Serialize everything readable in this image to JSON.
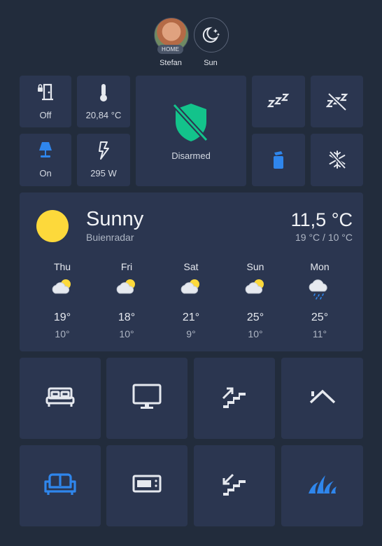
{
  "header": {
    "person": {
      "name": "Stefan",
      "state": "HOME"
    },
    "sun": {
      "name": "Sun"
    }
  },
  "tiles": {
    "door": {
      "state": "Off",
      "icon": "door-lock-icon"
    },
    "temperature": {
      "state": "20,84 °C",
      "icon": "thermometer-icon"
    },
    "alarm": {
      "state": "Disarmed",
      "icon": "shield-off-icon",
      "color": "#13c38b"
    },
    "sleep": {
      "icon": "sleep-icon"
    },
    "sleep_off": {
      "icon": "sleep-off-icon"
    },
    "lamp": {
      "state": "On",
      "icon": "lamp-icon",
      "color": "#2f86ec"
    },
    "power": {
      "state": "295 W",
      "icon": "flash-icon"
    },
    "air_freshener": {
      "icon": "spray-bottle-icon",
      "color": "#2f86ec"
    },
    "snowflake_off": {
      "icon": "snowflake-off-icon"
    }
  },
  "weather": {
    "condition": "Sunny",
    "source": "Buienradar",
    "temperature": "11,5 °C",
    "range": "19 °C / 10 °C",
    "sun_color": "#fdd93b",
    "forecast": [
      {
        "day": "Thu",
        "high": "19°",
        "low": "10°",
        "icon": "partly-cloudy-icon"
      },
      {
        "day": "Fri",
        "high": "18°",
        "low": "10°",
        "icon": "partly-cloudy-icon"
      },
      {
        "day": "Sat",
        "high": "21°",
        "low": "9°",
        "icon": "partly-cloudy-icon"
      },
      {
        "day": "Sun",
        "high": "25°",
        "low": "10°",
        "icon": "partly-cloudy-icon"
      },
      {
        "day": "Mon",
        "high": "25°",
        "low": "11°",
        "icon": "rainy-icon"
      }
    ]
  },
  "rooms": [
    {
      "icon": "bed-icon"
    },
    {
      "icon": "monitor-icon"
    },
    {
      "icon": "stairs-up-icon"
    },
    {
      "icon": "roof-icon"
    },
    {
      "icon": "sofa-icon",
      "color": "#2f86ec"
    },
    {
      "icon": "microwave-icon"
    },
    {
      "icon": "stairs-down-icon"
    },
    {
      "icon": "grass-icon",
      "color": "#2f86ec"
    }
  ]
}
